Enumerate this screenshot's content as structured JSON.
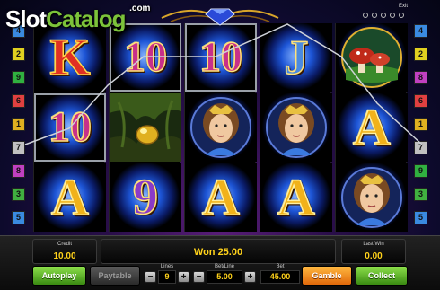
{
  "watermark": {
    "main": "Slot",
    "accent": "Catalog",
    "suffix": ".com"
  },
  "top_bar": {
    "exit_label": "Exit",
    "icons": [
      "settings-icon",
      "sound-icon",
      "help-icon",
      "info-icon",
      "fullscreen-icon"
    ]
  },
  "line_indicators": {
    "left": [
      {
        "label": "4",
        "color": "#3a8ae0"
      },
      {
        "label": "2",
        "color": "#e0d020"
      },
      {
        "label": "9",
        "color": "#30b040"
      },
      {
        "label": "6",
        "color": "#e04040"
      },
      {
        "label": "1",
        "color": "#e0b020"
      },
      {
        "label": "7",
        "color": "#c0c0c0"
      },
      {
        "label": "8",
        "color": "#c040c0"
      },
      {
        "label": "3",
        "color": "#40b040"
      },
      {
        "label": "5",
        "color": "#3a8ae0"
      }
    ],
    "right": [
      {
        "label": "4",
        "color": "#3a8ae0"
      },
      {
        "label": "2",
        "color": "#e0d020"
      },
      {
        "label": "8",
        "color": "#c040c0"
      },
      {
        "label": "6",
        "color": "#e04040"
      },
      {
        "label": "1",
        "color": "#e0b020"
      },
      {
        "label": "7",
        "color": "#c0c0c0"
      },
      {
        "label": "9",
        "color": "#30b040"
      },
      {
        "label": "3",
        "color": "#40b040"
      },
      {
        "label": "5",
        "color": "#3a8ae0"
      }
    ]
  },
  "reels": [
    [
      {
        "symbol": "K",
        "win": false
      },
      {
        "symbol": "10",
        "win": true
      },
      {
        "symbol": "A",
        "win": false
      }
    ],
    [
      {
        "symbol": "10",
        "win": true
      },
      {
        "symbol": "cave-gold",
        "win": false
      },
      {
        "symbol": "9",
        "win": false
      }
    ],
    [
      {
        "symbol": "10",
        "win": true
      },
      {
        "symbol": "princess",
        "win": false
      },
      {
        "symbol": "A",
        "win": false
      }
    ],
    [
      {
        "symbol": "J",
        "win": false
      },
      {
        "symbol": "princess",
        "win": false
      },
      {
        "symbol": "A",
        "win": false
      }
    ],
    [
      {
        "symbol": "mushroom",
        "win": false
      },
      {
        "symbol": "A",
        "win": false
      },
      {
        "symbol": "princess",
        "win": false
      }
    ]
  ],
  "panel": {
    "credit_label": "Credit",
    "credit_value": "10.00",
    "message": "Won 25.00",
    "last_win_label": "Last Win",
    "last_win_value": "0.00",
    "autoplay_label": "Autoplay",
    "paytable_label": "Paytable",
    "lines_label": "Lines",
    "lines_value": "9",
    "bet_line_label": "Bet/Line",
    "bet_line_value": "5.00",
    "bet_label": "Bet",
    "bet_value": "45.00",
    "minus": "−",
    "plus": "+",
    "gamble_label": "Gamble",
    "collect_label": "Collect"
  },
  "colors": {
    "win_text": "#ffd21a",
    "button_green": "#5ab82a",
    "button_orange": "#f08a20"
  }
}
